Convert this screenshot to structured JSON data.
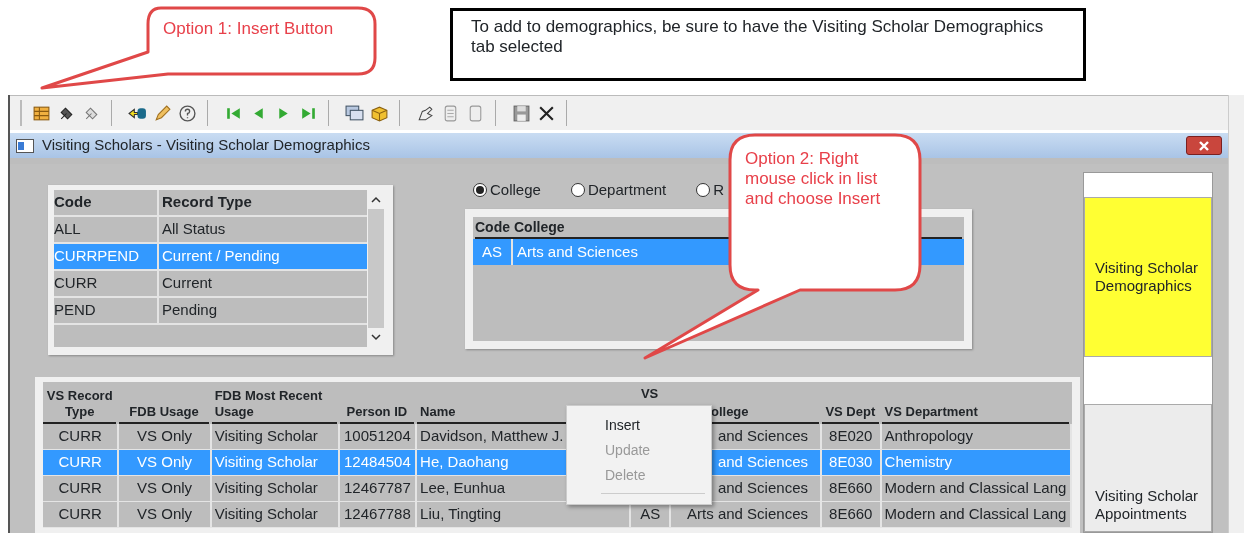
{
  "annotations": {
    "callouts": [
      {
        "text": "Option 1: Insert Button"
      },
      {
        "text": "Option 2:  Right mouse click in list and choose Insert"
      }
    ],
    "note": {
      "text": "To add to demographics, be sure to have the Visiting Scholar Demographics tab selected"
    }
  },
  "window": {
    "title": "Visiting Scholars - Visiting Scholar Demographics"
  },
  "record_type_list": {
    "columns": [
      "Code",
      "Record Type"
    ],
    "rows": [
      {
        "code": "ALL",
        "type": "All Status",
        "selected": false
      },
      {
        "code": "CURRPEND",
        "type": "Current / Pending",
        "selected": true
      },
      {
        "code": "CURR",
        "type": "Current",
        "selected": false
      },
      {
        "code": "PEND",
        "type": "Pending",
        "selected": false
      }
    ]
  },
  "scope_options": [
    {
      "label": "College",
      "selected": true
    },
    {
      "label": "Department",
      "selected": false
    },
    {
      "label": "R",
      "selected": false
    }
  ],
  "college_list": {
    "columns": [
      "Code",
      "College"
    ],
    "rows": [
      {
        "code": "AS",
        "college": "Arts and Sciences",
        "selected": true
      }
    ]
  },
  "grid": {
    "columns": [
      "VS Record Type",
      "FDB Usage",
      "FDB Most Recent Usage",
      "Person ID",
      "Name",
      "VS",
      "ollege",
      "VS Dept",
      "VS Department"
    ],
    "rows": [
      {
        "cells": [
          "CURR",
          "VS Only",
          "Visiting Scholar",
          "10051204",
          "Davidson, Matthew J.",
          "",
          "and Sciences",
          "8E020",
          "Anthropology"
        ],
        "selected": false
      },
      {
        "cells": [
          "CURR",
          "VS Only",
          "Visiting Scholar",
          "12484504",
          "He, Daohang",
          "",
          "and Sciences",
          "8E030",
          "Chemistry"
        ],
        "selected": true
      },
      {
        "cells": [
          "CURR",
          "VS Only",
          "Visiting Scholar",
          "12467787",
          "Lee, Eunhua",
          "",
          "and Sciences",
          "8E660",
          "Modern and Classical Lang"
        ],
        "selected": false
      },
      {
        "cells": [
          "CURR",
          "VS Only",
          "Visiting Scholar",
          "12467788",
          "Liu, Tingting",
          "AS",
          "Arts and Sciences",
          "8E660",
          "Modern and Classical Lang"
        ],
        "selected": false
      }
    ]
  },
  "context_menu": {
    "items": [
      {
        "label": "Insert",
        "disabled": false
      },
      {
        "label": "Update",
        "disabled": true
      },
      {
        "label": "Delete",
        "disabled": true
      }
    ]
  },
  "side_tabs": [
    {
      "label": "Visiting Scholar Demographics",
      "selected": true
    },
    {
      "label": "Visiting Scholar Appointments",
      "selected": false
    }
  ]
}
